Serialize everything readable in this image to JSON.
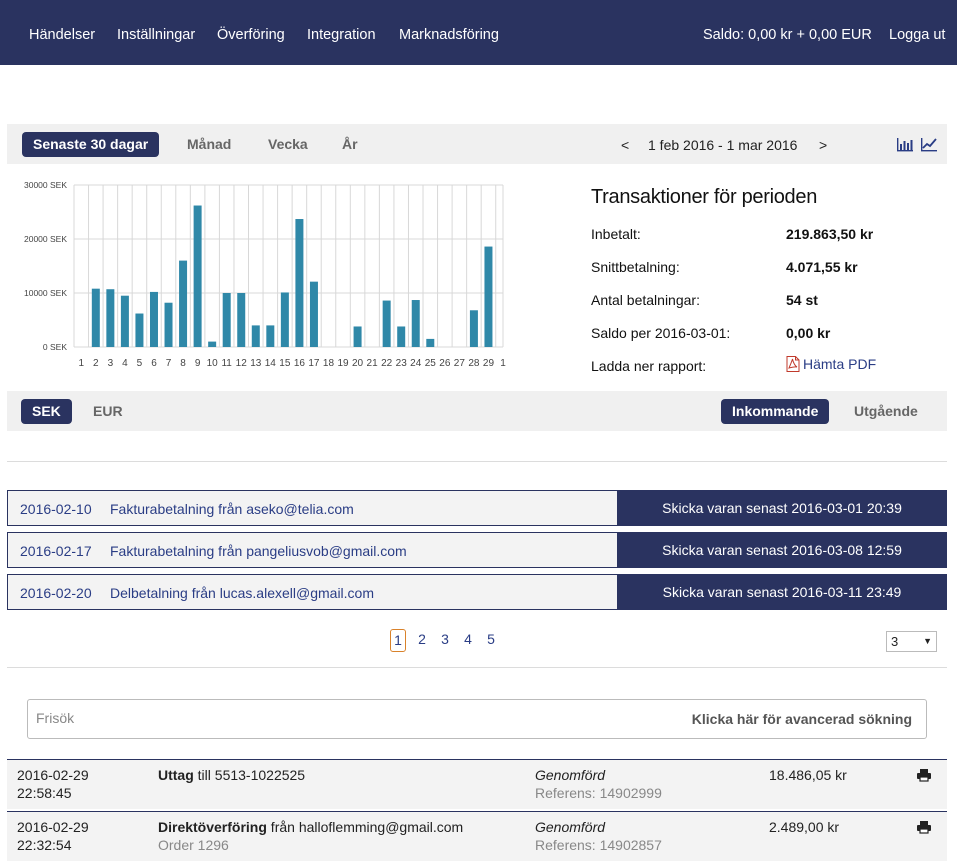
{
  "nav": {
    "items": [
      "Händelser",
      "Inställningar",
      "Överföring",
      "Integration",
      "Marknadsföring"
    ],
    "balance": "Saldo: 0,00 kr + 0,00 EUR",
    "logout": "Logga ut"
  },
  "period": {
    "tabs": [
      "Senaste 30 dagar",
      "Månad",
      "Vecka",
      "År"
    ],
    "active": "Senaste 30 dagar",
    "prev": "<",
    "range": "1 feb 2016 - 1 mar 2016",
    "next": ">",
    "icons": [
      "bar-chart-icon",
      "line-chart-icon"
    ]
  },
  "chart_data": {
    "type": "bar",
    "categories": [
      "1",
      "2",
      "3",
      "4",
      "5",
      "6",
      "7",
      "8",
      "9",
      "10",
      "11",
      "12",
      "13",
      "14",
      "15",
      "16",
      "17",
      "18",
      "19",
      "20",
      "21",
      "22",
      "23",
      "24",
      "25",
      "26",
      "27",
      "28",
      "29",
      "1"
    ],
    "values": [
      0,
      10800,
      10700,
      9500,
      6200,
      10200,
      8200,
      16000,
      26200,
      1000,
      10000,
      10000,
      4000,
      4000,
      10100,
      23700,
      12100,
      0,
      0,
      3800,
      0,
      8600,
      3800,
      8700,
      1500,
      0,
      0,
      6800,
      18600,
      0
    ],
    "ylim": [
      0,
      30000
    ],
    "yticks": [
      "0 SEK",
      "10000 SEK",
      "20000 SEK",
      "30000 SEK"
    ],
    "yticks_values": [
      0,
      10000,
      20000,
      30000
    ],
    "grid": true,
    "bar_color": "#2f88a8"
  },
  "summary": {
    "title": "Transaktioner för perioden",
    "rows": [
      {
        "label": "Inbetalt:",
        "value": "219.863,50 kr"
      },
      {
        "label": "Snittbetalning:",
        "value": "4.071,55 kr"
      },
      {
        "label": "Antal betalningar:",
        "value": "54 st"
      },
      {
        "label": "Saldo per 2016-03-01:",
        "value": "0,00 kr"
      }
    ],
    "report_label": "Ladda ner rapport:",
    "pdf_link": "Hämta PDF"
  },
  "currency": {
    "tabs": [
      "SEK",
      "EUR"
    ],
    "active": "SEK",
    "direction": [
      "Inkommande",
      "Utgående"
    ],
    "active_direction": "Inkommande"
  },
  "pending": [
    {
      "date": "2016-02-10",
      "desc": "Fakturabetalning från aseko@telia.com",
      "action": "Skicka varan senast 2016-03-01 20:39"
    },
    {
      "date": "2016-02-17",
      "desc": "Fakturabetalning från pangeliusvob@gmail.com",
      "action": "Skicka varan senast 2016-03-08 12:59"
    },
    {
      "date": "2016-02-20",
      "desc": "Delbetalning från lucas.alexell@gmail.com",
      "action": "Skicka varan senast 2016-03-11 23:49"
    }
  ],
  "pagination": {
    "pages": [
      "1",
      "2",
      "3",
      "4",
      "5"
    ],
    "current": "1",
    "per_page": "3"
  },
  "search": {
    "placeholder": "Frisök",
    "advanced": "Klicka här för avancerad sökning"
  },
  "payments": [
    {
      "date": "2016-02-29",
      "time": "22:58:45",
      "type": "Uttag",
      "type_rest": " till 5513-1022525",
      "sub": "",
      "status": "Genomförd",
      "reference": "Referens: 14902999",
      "amount": "18.486,05 kr"
    },
    {
      "date": "2016-02-29",
      "time": "22:32:54",
      "type": "Direktöverföring",
      "type_rest": " från halloflemming@gmail.com",
      "sub": "Order 1296",
      "status": "Genomförd",
      "reference": "Referens: 14902857",
      "amount": "2.489,00 kr"
    }
  ],
  "colors": {
    "navy": "#2a3360",
    "link": "#2a3d85",
    "bar": "#2f88a8",
    "pdf": "#c0392b"
  }
}
